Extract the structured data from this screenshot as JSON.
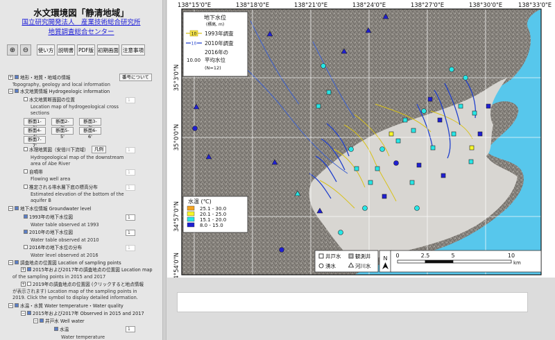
{
  "header": {
    "title": "水文環境図「静清地域」",
    "org_line1": "国立研究開発法人　産業技術総合研究所",
    "org_line2": "地質調査総合センター"
  },
  "toolbar": {
    "zoom_in_icon": "magnifier-plus-icon",
    "zoom_out_icon": "magnifier-minus-icon",
    "usage_label": "使い方",
    "manual_label": "説明書",
    "pdf_label": "PDF版",
    "initial_view_label": "初期画面",
    "notes_label": "注意事項"
  },
  "layers": {
    "geo_info_jp": "地形・地質・地域の情報",
    "geo_info_en": "Topography, geology and local information",
    "number_button": "番号について",
    "hydrogeo_jp": "水文地質情報 Hydrogeologic information",
    "sections_jp": "水文地質断面図の位置",
    "sections_en1": "Location map of hydrogeological cross",
    "sections_en2": "sections",
    "section_buttons": [
      "断面1-1'",
      "断面2-2'",
      "断面3-3'",
      "断面4-4'",
      "断面5-5'",
      "断面6-6'",
      "断面7-7'"
    ],
    "hydromap_jp": "水理地質図（安倍川下流域）",
    "legend_button": "凡例",
    "hydromap_en1": "Hydrogeological map of the downstream",
    "hydromap_en2": "area of Abe River",
    "flowing_jp": "自噴帯",
    "flowing_en": "Flowing well area",
    "aquifer_jp": "推定される帯水層下底の標高分布",
    "aquifer_en1": "Estimated elevation of the bottom of the",
    "aquifer_en2": "aquifer B",
    "gwlevel_jp": "地下水位情報 Groundwater level",
    "gw1993_jp": "1993年の地下水位図",
    "gw1993_en": "Water table observed at 1993",
    "gw2010_jp": "2010年の地下水位図",
    "gw2010_en": "Water table observed at 2010",
    "gw2016_jp": "2016年の地下水位の分布",
    "gw2016_en": "Water level observed at 2016",
    "sampling_jp": "調査地点の位置図 Location of sampling points",
    "sampling1517": "2015年および2017年の調査地点の位置図 Location map",
    "sampling1517_en": "of the sampling points in 2015 and 2017",
    "sampling2019": "2019年の調査地点の位置図 (クリックすると地点情報",
    "sampling2019b": "が表示されます) Location map of the sampling points in",
    "sampling2019c": "2019. Click the symbol to display detailed information.",
    "quality_jp": "水温・水質 Water temperature・Water quality",
    "quality1517": "2015年および2017年 Observed in 2015 and 2017",
    "well_water": "井戸水 Well water",
    "water_temp_jp": "水温",
    "water_temp_en": "Water temperature",
    "select_value": "1"
  },
  "map": {
    "lon_labels": [
      "138°15'0\"E",
      "138°18'0\"E",
      "138°21'0\"E",
      "138°24'0\"E",
      "138°27'0\"E",
      "138°30'0\"E",
      "138°33'0\"E"
    ],
    "lat_labels": [
      "35°3'0\"N",
      "35°0'0\"N",
      "34°57'0\"N",
      "34°54'0\"N"
    ],
    "gw_legend": {
      "title": "地下水位",
      "subtitle": "(標高, m)",
      "item1993": "1993年調査",
      "item2010": "2010年調査",
      "sample_1993": "10",
      "sample_2010": "10",
      "sample_2016": "10.00",
      "item2016_a": "2016年の",
      "item2016_b": "平均水位",
      "item2016_c": "(N=12)"
    },
    "temp_legend": {
      "title": "水温 (℃)",
      "ranges": [
        {
          "label": "25.1 - 30.0",
          "color": "#f4a422"
        },
        {
          "label": "20.1 - 25.0",
          "color": "#f6f62a"
        },
        {
          "label": "15.1 - 20.0",
          "color": "#27e6e6"
        },
        {
          "label": "8.0 - 15.0",
          "color": "#1f1fd1"
        }
      ]
    },
    "symbol_legend": {
      "well": "井戸水",
      "obs_well": "観測井",
      "spring": "湧水",
      "river": "河川水"
    },
    "north_label": "N",
    "scale": {
      "ticks": [
        "0",
        "2.5",
        "5",
        "10"
      ],
      "unit": "km"
    },
    "colors": {
      "sea": "#57c7ec",
      "land": "#9a9690",
      "plain": "#d8d6d2"
    }
  }
}
